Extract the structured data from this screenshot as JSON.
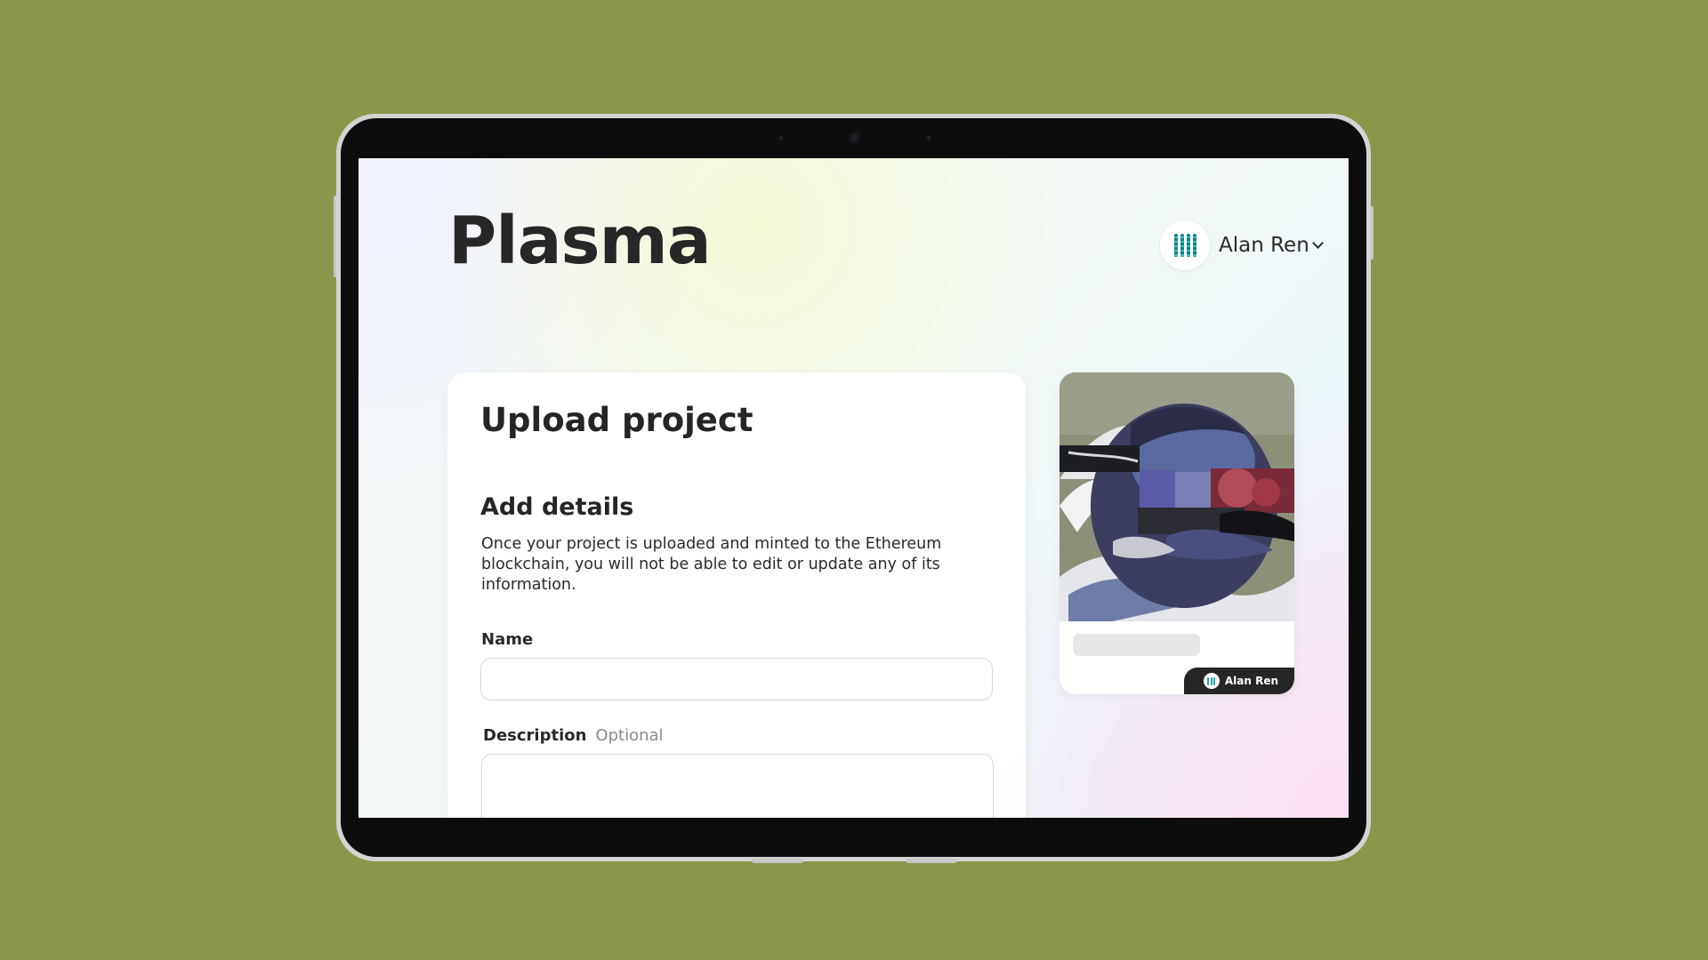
{
  "app": {
    "logo_text": "Plasma"
  },
  "account": {
    "name": "Alan Ren",
    "avatar_icon": "striped-bars-avatar-icon",
    "menu_icon": "chevron-down-icon"
  },
  "form": {
    "title": "Upload project",
    "section_title": "Add details",
    "section_description": "Once your project is uploaded and minted to the Ethereum blockchain, you will not be able to edit or update any of its information.",
    "name_label": "Name",
    "name_value": "",
    "description_label": "Description",
    "description_optional": "Optional",
    "description_value": ""
  },
  "preview": {
    "creator_name": "Alan Ren",
    "colors": {
      "accent_teal": "#2aa3ab",
      "pill_dark": "#262626"
    }
  },
  "background_color": "#89974b"
}
